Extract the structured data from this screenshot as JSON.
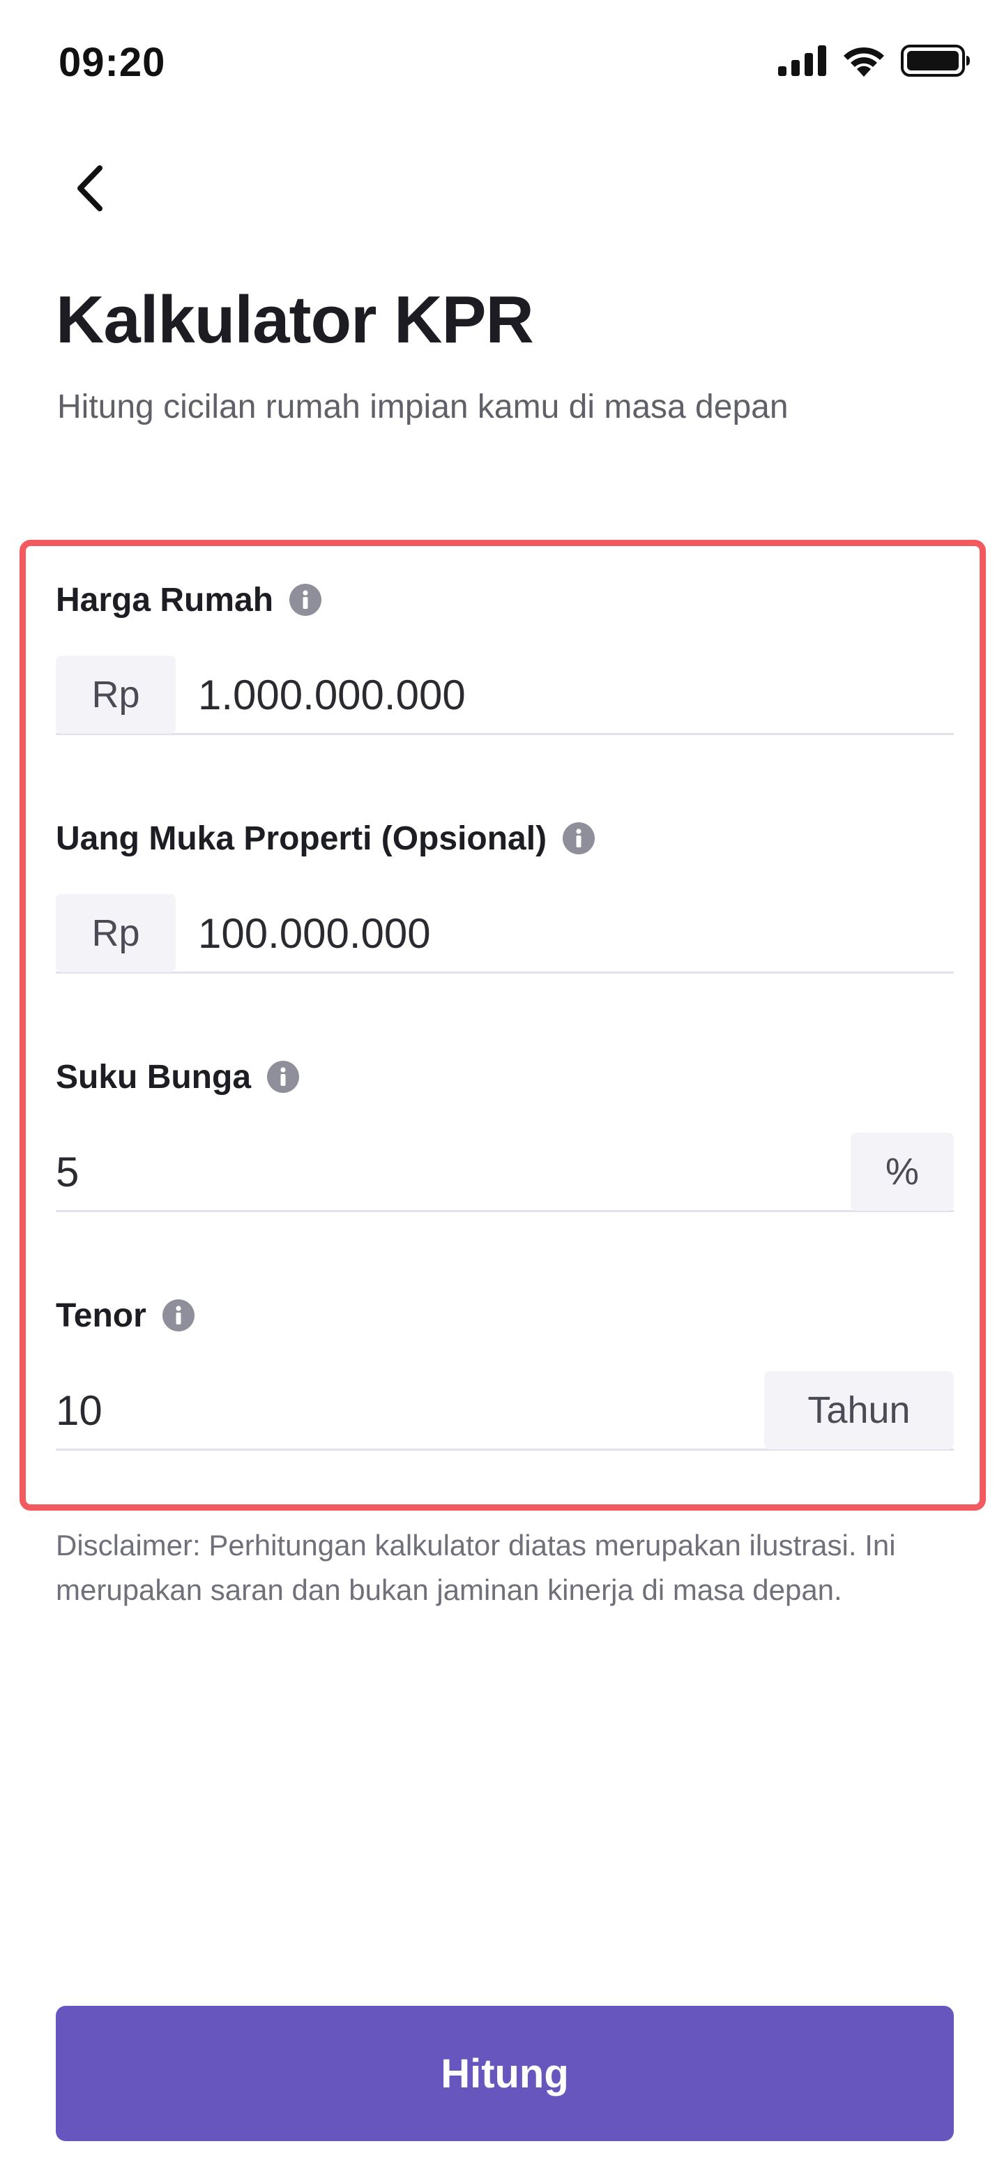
{
  "status_bar": {
    "time": "09:20",
    "icons": [
      "signal-icon",
      "wifi-icon",
      "battery-icon"
    ]
  },
  "header": {
    "back_icon": "chevron-left-icon",
    "title": "Kalkulator KPR",
    "subtitle": "Hitung cicilan rumah impian kamu di masa depan"
  },
  "form": {
    "highlight_color": "#f25a5e",
    "fields": [
      {
        "label": "Harga Rumah",
        "prefix": "Rp",
        "value": "1.000.000.000"
      },
      {
        "label": "Uang Muka Properti (Opsional)",
        "prefix": "Rp",
        "value": "100.000.000"
      },
      {
        "label": "Suku Bunga",
        "value": "5",
        "suffix": "%"
      },
      {
        "label": "Tenor",
        "value": "10",
        "suffix": "Tahun"
      }
    ]
  },
  "disclaimer": "Disclaimer: Perhitungan kalkulator diatas merupakan ilustrasi. Ini merupakan saran dan bukan jaminan kinerja di masa depan.",
  "action": {
    "label": "Hitung",
    "color": "#6756be"
  }
}
